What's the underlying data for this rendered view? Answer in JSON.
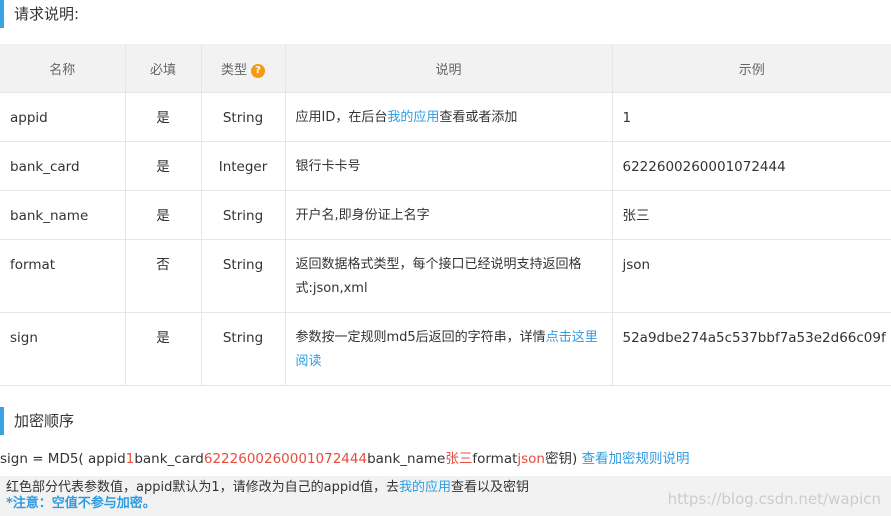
{
  "section1_title": "请求说明:",
  "section2_title": "加密顺序",
  "table": {
    "headers": [
      "名称",
      "必填",
      "类型",
      "说明",
      "示例"
    ],
    "help_icon_glyph": "?",
    "rows": [
      {
        "name": "appid",
        "required": "是",
        "type": "String",
        "desc_pre": "应用ID，在后台",
        "desc_link": "我的应用",
        "desc_post": "查看或者添加",
        "example": "1"
      },
      {
        "name": "bank_card",
        "required": "是",
        "type": "Integer",
        "desc_pre": "银行卡卡号",
        "desc_link": "",
        "desc_post": "",
        "example": "6222600260001072444"
      },
      {
        "name": "bank_name",
        "required": "是",
        "type": "String",
        "desc_pre": "开户名,即身份证上名字",
        "desc_link": "",
        "desc_post": "",
        "example": "张三"
      },
      {
        "name": "format",
        "required": "否",
        "type": "String",
        "desc_pre": "返回数据格式类型，每个接口已经说明支持返回格式:json,xml",
        "desc_link": "",
        "desc_post": "",
        "example": "json"
      },
      {
        "name": "sign",
        "required": "是",
        "type": "String",
        "desc_pre": "参数按一定规则md5后返回的字符串，详情",
        "desc_link": "点击这里阅读",
        "desc_post": "",
        "example": "52a9dbe274a5c537bbf7a53e2d66c09f"
      }
    ]
  },
  "formula": {
    "p1": "sign = MD5( appid",
    "v1": "1",
    "p2": "bank_card",
    "v2": "6222600260001072444",
    "p3": "bank_name",
    "v3": "张三",
    "p4": "format",
    "v4": "json",
    "p5": "密钥) ",
    "link": "查看加密规则说明"
  },
  "note": {
    "line1_pre": "红色部分代表参数值，appid默认为1，请修改为自己的appid值，去",
    "line1_link": "我的应用",
    "line1_post": "查看以及密钥",
    "line2": "*注意：空值不参与加密。"
  },
  "watermark": "https://blog.csdn.net/wapicn",
  "colors": {
    "accent": "#3aa3e3",
    "link": "#2f9de2",
    "value_red": "#e74c3c",
    "help_icon": "#f39c12"
  }
}
